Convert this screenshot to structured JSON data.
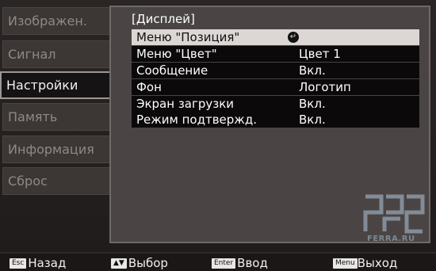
{
  "sidebar": {
    "items": [
      {
        "label": "Изображен."
      },
      {
        "label": "Сигнал"
      },
      {
        "label": "Настройки"
      },
      {
        "label": "Память"
      },
      {
        "label": "Информация"
      },
      {
        "label": "Сброс"
      }
    ]
  },
  "panel": {
    "title": "[Дисплей]",
    "rows": [
      {
        "label": "Меню \"Позиция\"",
        "value": ""
      },
      {
        "label": "Меню \"Цвет\"",
        "value": "Цвет 1"
      },
      {
        "label": "Сообщение",
        "value": "Вкл."
      },
      {
        "label": "Фон",
        "value": "Логотип"
      },
      {
        "label": "Экран загрузки",
        "value": "Вкл."
      },
      {
        "label": "Режим подтвержд.",
        "value": "Вкл."
      }
    ]
  },
  "footer": {
    "back_key": "Esc",
    "back_label": "Назад",
    "select_label": "Выбор",
    "enter_key": "Enter",
    "enter_label": "Ввод",
    "menu_key": "Menu",
    "menu_label": "Выход"
  },
  "watermark": {
    "text": "FERRA.RU"
  },
  "colors": {
    "background": "#1e1b1a",
    "panel": "#4a4544",
    "selected_row": "#dcd7d5",
    "row": "#0b0909"
  }
}
